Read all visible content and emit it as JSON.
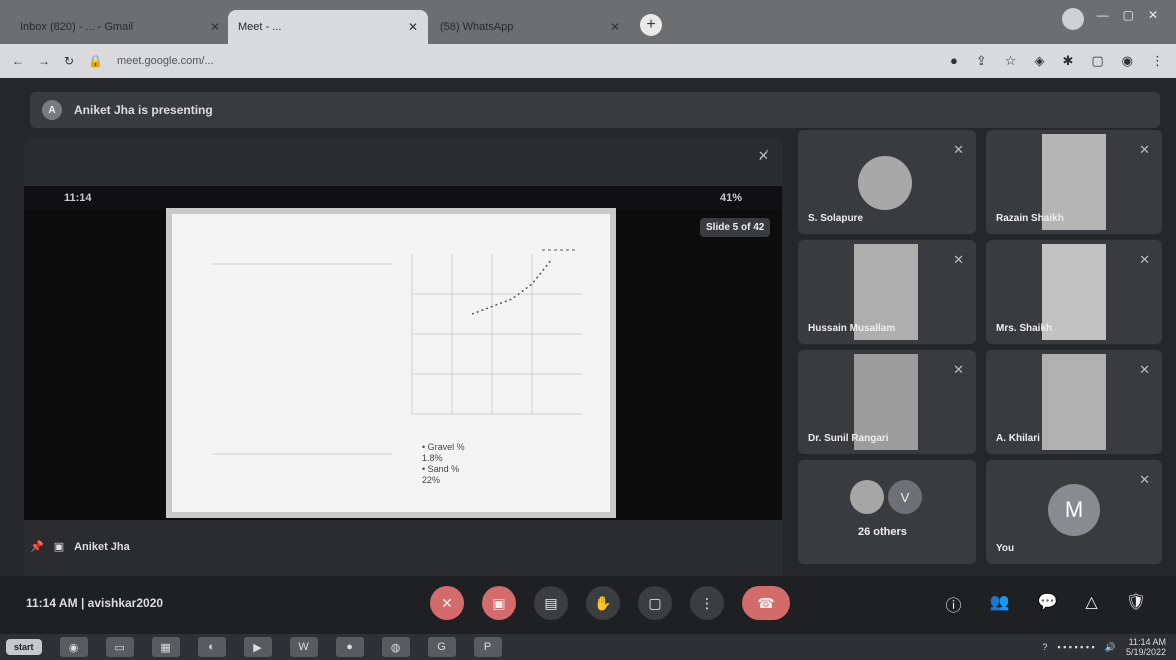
{
  "browser": {
    "tabs": [
      {
        "label": "Inbox (820) - ... - Gmail"
      },
      {
        "label": "Meet - ..."
      },
      {
        "label": "(58) WhatsApp"
      }
    ],
    "url": "meet.google.com/..."
  },
  "meet": {
    "banner_avatar": "A",
    "banner_text": "Aniket Jha is presenting",
    "phone_time": "11:14",
    "phone_battery": "41%",
    "slide_counter": "Slide 5 of 42",
    "slide_legend": {
      "gravel_label": "Gravel %",
      "gravel_value": "1.8%",
      "sand_label": "Sand %",
      "sand_value": "22%"
    },
    "presenter_name": "Aniket Jha",
    "participants": [
      {
        "name": "S. Solapure"
      },
      {
        "name": "Razain Shaikh"
      },
      {
        "name": "Hussain Musallam"
      },
      {
        "name": "Mrs. Shaikh"
      },
      {
        "name": "Dr. Sunil Rangari"
      },
      {
        "name": "A. Khilari"
      }
    ],
    "others_label": "26 others",
    "others_avatar": "V",
    "you_label": "You",
    "you_avatar": "M",
    "meeting_time": "11:14 AM",
    "separator": "|",
    "meeting_code": "avishkar2020"
  },
  "taskbar": {
    "start_label": "start",
    "clock_time": "11:14 AM",
    "clock_date": "5/19/2022"
  }
}
